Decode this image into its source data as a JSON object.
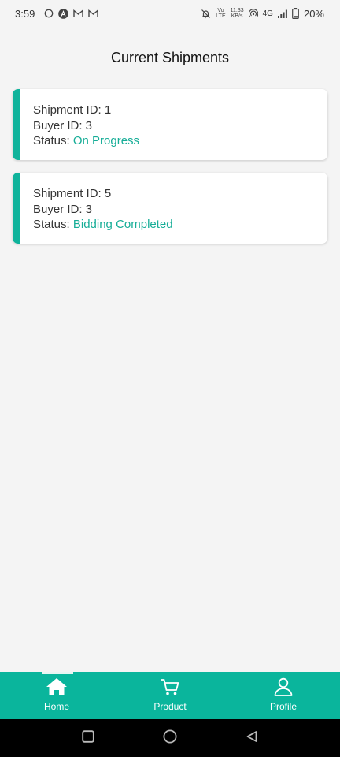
{
  "status_bar": {
    "time": "3:59",
    "volte_top": "Vo",
    "volte_bottom": "LTE",
    "speed_value": "11.33",
    "speed_unit": "KB/s",
    "network": "4G",
    "battery_percent": "20%"
  },
  "page": {
    "title": "Current Shipments"
  },
  "shipments": [
    {
      "shipment_label": "Shipment ID: 1",
      "buyer_label": "Buyer ID: 3",
      "status_prefix": "Status: ",
      "status_value": "On Progress"
    },
    {
      "shipment_label": "Shipment ID: 5",
      "buyer_label": "Buyer ID: 3",
      "status_prefix": "Status: ",
      "status_value": "Bidding Completed"
    }
  ],
  "bottom_nav": {
    "items": [
      {
        "label": "Home",
        "icon": "home-icon",
        "active": true
      },
      {
        "label": "Product",
        "icon": "cart-icon",
        "active": false
      },
      {
        "label": "Profile",
        "icon": "profile-icon",
        "active": false
      }
    ]
  },
  "colors": {
    "accent": "#0ab59c",
    "status_text": "#16ad97",
    "background": "#f4f4f4"
  }
}
